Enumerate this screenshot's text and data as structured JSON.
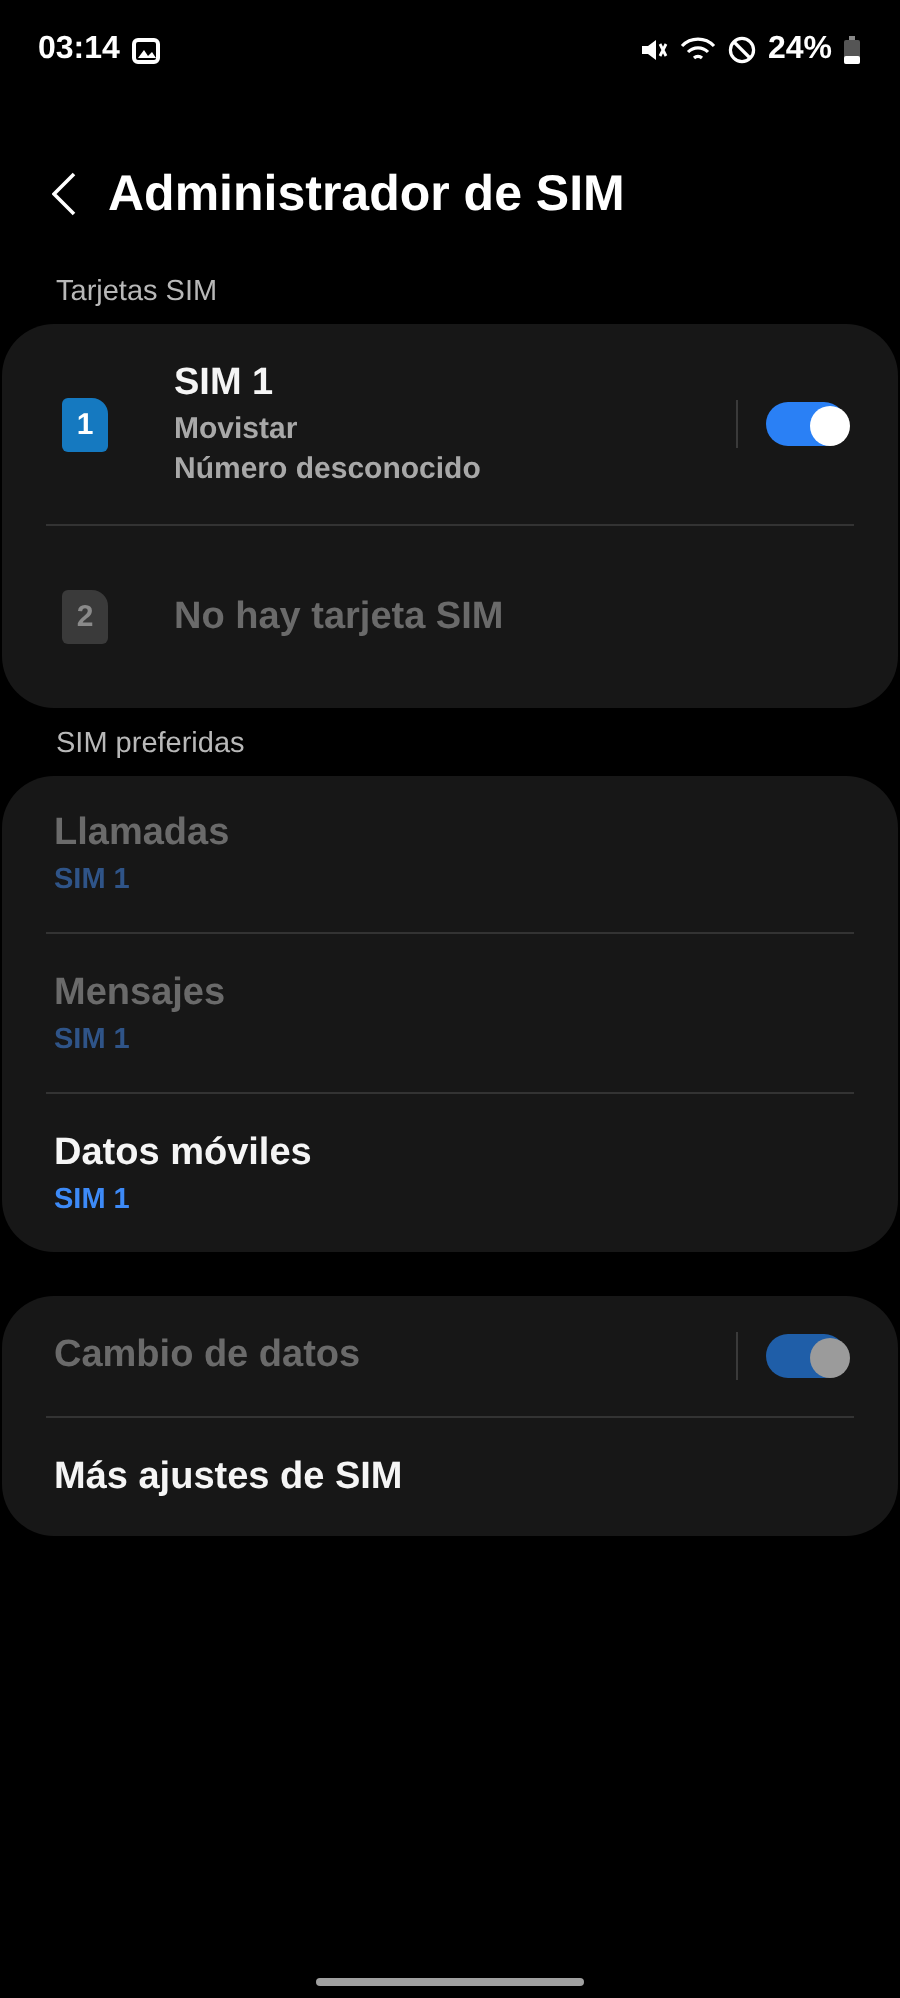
{
  "status_bar": {
    "time": "03:14",
    "battery": "24%"
  },
  "header": {
    "title": "Administrador de SIM"
  },
  "groups": [
    {
      "label": "Tarjetas SIM",
      "items": [
        {
          "kind": "sim",
          "slot": "1",
          "title": "SIM 1",
          "lines": [
            "Movistar",
            "Número desconocido"
          ],
          "disabled": false,
          "on": true
        },
        {
          "kind": "sim",
          "slot": "2",
          "title": "No hay tarjeta SIM",
          "disabled": true
        }
      ]
    },
    {
      "label": "SIM preferidas",
      "items": [
        {
          "kind": "preference",
          "title": "Llamadas",
          "value": "SIM 1",
          "disabled": true
        },
        {
          "kind": "preference",
          "title": "Mensajes",
          "value": "SIM 1",
          "disabled": true
        },
        {
          "kind": "preference",
          "title": "Datos móviles",
          "value": "SIM 1",
          "disabled": false
        }
      ]
    },
    {
      "items": [
        {
          "kind": "switch",
          "title": "Cambio de datos",
          "disabled": true,
          "on": true
        },
        {
          "kind": "link",
          "title": "Más ajustes de SIM",
          "disabled": false
        }
      ]
    }
  ]
}
